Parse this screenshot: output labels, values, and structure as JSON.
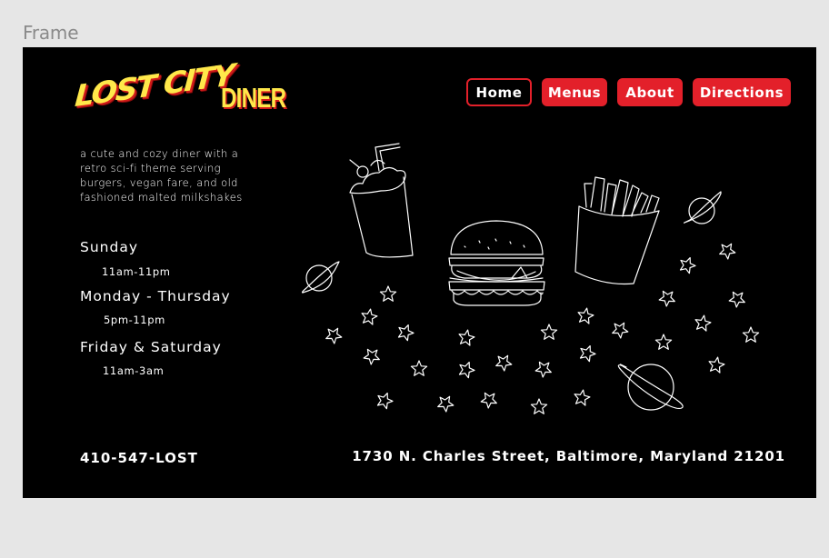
{
  "frame_label": "Frame",
  "logo": {
    "main": "LOST CITY",
    "sub": "DINER"
  },
  "nav": [
    {
      "label": "Home",
      "active": true
    },
    {
      "label": "Menus",
      "active": false
    },
    {
      "label": "About",
      "active": false
    },
    {
      "label": "Directions",
      "active": false
    }
  ],
  "tagline": "a cute and cozy diner with a retro sci-fi theme serving burgers, vegan fare, and old fashioned malted milkshakes",
  "hours": [
    {
      "day": "Sunday",
      "time": "11am-11pm"
    },
    {
      "day": "Monday - Thursday",
      "time": "5pm-11pm"
    },
    {
      "day": "Friday & Saturday",
      "time": "11am-3am"
    }
  ],
  "contact": {
    "phone": "410-547-LOST",
    "address": "1730 N. Charles Street, Baltimore, Maryland 21201"
  },
  "colors": {
    "accent": "#e3202a",
    "logo": "#ffe84a",
    "background": "#000000",
    "canvas": "#e6e6e6"
  },
  "icons": [
    "milkshake-icon",
    "burger-icon",
    "fries-icon",
    "planet-icon",
    "star-icon"
  ]
}
